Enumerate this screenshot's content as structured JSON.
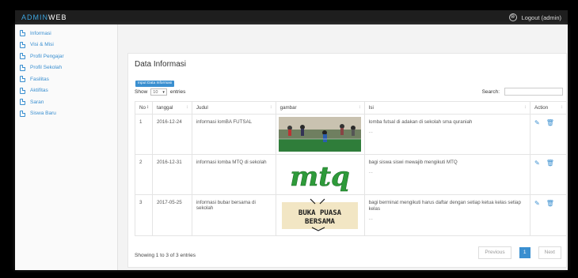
{
  "app": {
    "brand_accent": "ADMIN",
    "brand_rest": "WEB",
    "logout_label": "Logout (admin)"
  },
  "sidebar": {
    "items": [
      {
        "label": "Informasi"
      },
      {
        "label": "Visi & Misi"
      },
      {
        "label": "Profil Pengajar"
      },
      {
        "label": "Profil Sekolah"
      },
      {
        "label": "Fasilitas"
      },
      {
        "label": "Aktifitas"
      },
      {
        "label": "Saran"
      },
      {
        "label": "Siswa Baru"
      }
    ]
  },
  "main": {
    "title": "Data Informasi",
    "add_button": "Input Data Informasi",
    "show_prefix": "Show",
    "show_value": "10",
    "show_suffix": "entries",
    "search_label": "Search:",
    "columns": [
      "No",
      "tanggal",
      "Judul",
      "gambar",
      "Isi",
      "Action"
    ],
    "rows": [
      {
        "no": "1",
        "tanggal": "2016-12-24",
        "judul": "informasi lomBA FUTSAL",
        "isi": "lomba futsal di adakan di sekolah sma quraniah",
        "more": "...",
        "image": "futsal-photo"
      },
      {
        "no": "2",
        "tanggal": "2016-12-31",
        "judul": "informasi lomba MTQ di sekolah",
        "isi": "bagi siswa siswi mewajib mengikuti MTQ",
        "more": "...",
        "image": "mtq-logo"
      },
      {
        "no": "3",
        "tanggal": "2017-05-25",
        "judul": "informasi bubar bersama di sekolah",
        "isi": "bagi berminat mengikuti harus daftar dengan setiap ketua kelas setiap kelas",
        "more": "...",
        "image": "buka-puasa-banner"
      }
    ],
    "image_texts": {
      "mtq": "mtq",
      "buka": "BUKA PUASA",
      "bersama": "BERSAMA"
    },
    "footer_info": "Showing 1 to 3 of 3 entries",
    "pagination": {
      "previous": "Previous",
      "current": "1",
      "next": "Next"
    }
  },
  "colors": {
    "accent": "#3a8fd0",
    "topbar": "#1e1e1e",
    "mtq_green": "#2e9b3a"
  }
}
